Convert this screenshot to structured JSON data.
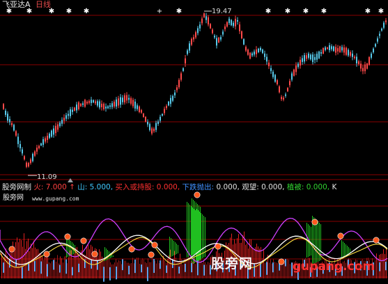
{
  "window": {
    "stock_name": "飞亚达A",
    "period": "日线"
  },
  "price_chart": {
    "high_label": "19.47",
    "low_label": "11.09"
  },
  "indicator": {
    "name": "股旁网制",
    "items": [
      {
        "text": "火:",
        "color": "#ff4040"
      },
      {
        "text": "7.000",
        "color": "#ff4040"
      },
      {
        "text": "↑",
        "color": "#ff4040"
      },
      {
        "text": "山:",
        "color": "#40c8ff"
      },
      {
        "text": "5.000,",
        "color": "#40c8ff"
      },
      {
        "text": "买入或持股:",
        "color": "#ff3030"
      },
      {
        "text": "0.000,",
        "color": "#ff3030"
      },
      {
        "text": "下跌抛出:",
        "color": "#4090ff"
      },
      {
        "text": "0.000,",
        "color": "#e0e0e0"
      },
      {
        "text": "观望:",
        "color": "#e0e0e0"
      },
      {
        "text": "0.000,",
        "color": "#e0e0e0"
      },
      {
        "text": "植被:",
        "color": "#30d030"
      },
      {
        "text": "0.000,",
        "color": "#30d030"
      },
      {
        "text": "K",
        "color": "#e0e0e0"
      }
    ]
  },
  "sub_panel": {
    "title": "股旁网",
    "url": "www.gupang.com"
  },
  "watermark": {
    "cn": "股旁网",
    "en": "gupang.com"
  },
  "colors": {
    "up": "#ff4a4a",
    "down": "#57c8e8",
    "grid": "#8a0000",
    "magenta": "#d040ff",
    "green_bars": "#20c020",
    "red_bars": "#e02020",
    "marker": "#ff5a1f"
  }
}
